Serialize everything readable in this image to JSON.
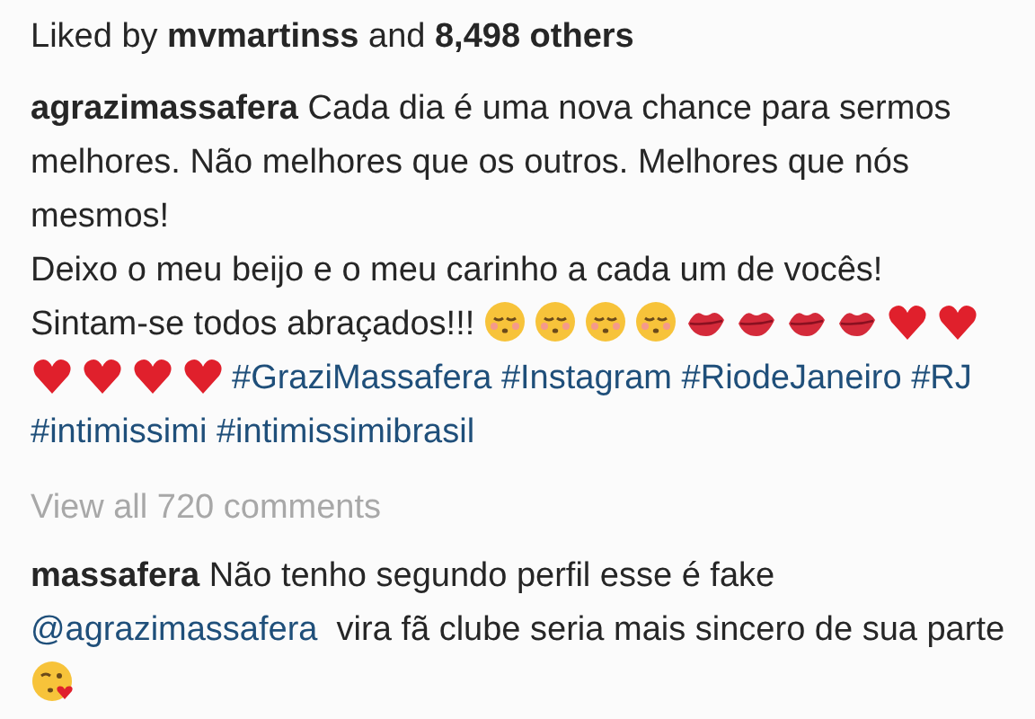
{
  "likes": {
    "text": "Liked by **mvmartinss** and **8,498 others**"
  },
  "caption": {
    "username": "agrazimassafera",
    "segments": [
      {
        "kind": "text",
        "text": "Cada dia é uma nova chance para sermos melhores. Não melhores que os outros. Melhores que nós mesmos!"
      },
      {
        "kind": "break"
      },
      {
        "kind": "text",
        "text": "Deixo o meu beijo e o meu carinho a cada um de vocês!  Sintam-se todos abraçados!!! "
      },
      {
        "kind": "kissing-face"
      },
      {
        "kind": "kissing-face"
      },
      {
        "kind": "kissing-face"
      },
      {
        "kind": "kissing-face"
      },
      {
        "kind": "lips"
      },
      {
        "kind": "lips"
      },
      {
        "kind": "lips"
      },
      {
        "kind": "lips"
      },
      {
        "kind": "heart"
      },
      {
        "kind": "heart"
      },
      {
        "kind": "heart"
      },
      {
        "kind": "heart"
      },
      {
        "kind": "heart"
      },
      {
        "kind": "heart"
      },
      {
        "kind": "hashtag",
        "text": "#GraziMassafera"
      },
      {
        "kind": "hashtag",
        "text": "#Instagram"
      },
      {
        "kind": "hashtag",
        "text": "#RiodeJaneiro"
      },
      {
        "kind": "hashtag",
        "text": "#RJ"
      },
      {
        "kind": "hashtag",
        "text": "#intimissimi"
      },
      {
        "kind": "hashtag",
        "text": "#intimissimibrasil"
      }
    ]
  },
  "view_all": "View all 720 comments",
  "comments": [
    {
      "username": "massafera",
      "segments": [
        {
          "kind": "text",
          "text": "Não tenho segundo perfil esse é fake "
        },
        {
          "kind": "mention",
          "text": "@agrazimassafera"
        },
        {
          "kind": "text",
          "text": "  vira fã clube seria mais sincero de sua parte "
        },
        {
          "kind": "blow-kiss-face"
        }
      ]
    }
  ]
}
